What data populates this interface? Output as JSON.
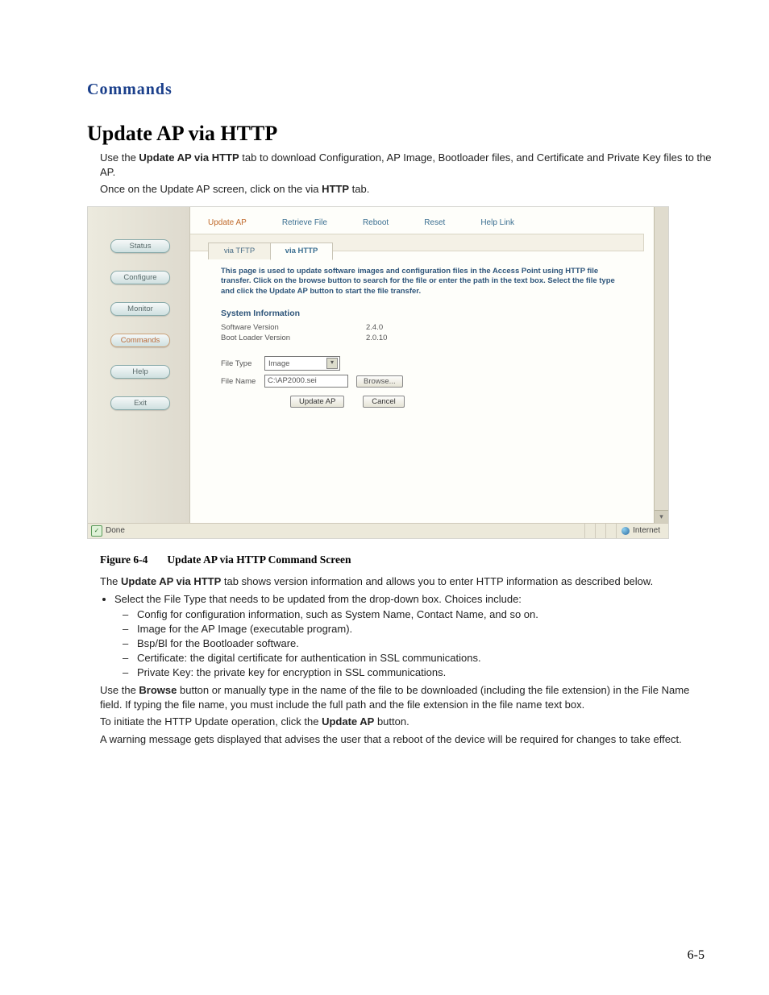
{
  "header": {
    "section": "Commands",
    "title": "Update AP via HTTP"
  },
  "intro": {
    "p1a": "Use the ",
    "p1b": "Update AP via HTTP",
    "p1c": " tab to download Configuration, AP Image, Bootloader files, and Certificate and Private Key files to the AP.",
    "p2a": "Once on the Update AP screen, click on the via ",
    "p2b": "HTTP",
    "p2c": " tab."
  },
  "screenshot": {
    "side": {
      "status": "Status",
      "configure": "Configure",
      "monitor": "Monitor",
      "commands": "Commands",
      "help": "Help",
      "exit": "Exit"
    },
    "top_tabs": {
      "update": "Update AP",
      "retrieve": "Retrieve File",
      "reboot": "Reboot",
      "reset": "Reset",
      "help": "Help Link"
    },
    "sub_tabs": {
      "tftp": "via TFTP",
      "http": "via HTTP"
    },
    "desc": "This page is used to update software images and configuration files in the Access Point using HTTP file transfer. Click on the browse button to search for the file or enter the path in the text box. Select the file type and click the Update AP button to start the file transfer.",
    "sys": {
      "head": "System Information",
      "sw_label": "Software Version",
      "sw_val": "2.4.0",
      "bl_label": "Boot Loader Version",
      "bl_val": "2.0.10"
    },
    "form": {
      "filetype_label": "File Type",
      "filetype_value": "Image",
      "filename_label": "File Name",
      "filename_value": "C:\\AP2000.sei",
      "browse": "Browse...",
      "update": "Update AP",
      "cancel": "Cancel"
    },
    "status": {
      "done": "Done",
      "zone": "Internet"
    }
  },
  "figure": {
    "num": "Figure 6-4",
    "title": "Update AP via HTTP Command Screen"
  },
  "after": {
    "p1a": "The ",
    "p1b": "Update AP via HTTP",
    "p1c": " tab shows version information and allows you to enter HTTP information as described below.",
    "li_top": "Select the File Type that needs to be updated from the drop-down box. Choices include:",
    "c1a": "Config",
    "c1b": " for configuration information, such as System Name, Contact Name, and so on.",
    "c2a": "Image",
    "c2b": " for the AP Image (executable program).",
    "c3a": "Bsp/Bl",
    "c3b": " for the Bootloader software.",
    "c4a": "Certificate",
    "c4b": ": the digital certificate for authentication in SSL communications.",
    "c5a": "Private Key",
    "c5b": ": the private key for encryption in SSL communications.",
    "p2a": "Use the ",
    "p2b": "Browse",
    "p2c": " button or manually type in the name of the file to be downloaded (including the file extension) in the File Name field. If typing the file name, you must include the full path and the file extension in the file name text box.",
    "p3a": "To initiate the HTTP Update operation, click the ",
    "p3b": "Update AP",
    "p3c": " button.",
    "p4": "A warning message gets displayed that advises the user that a reboot of the device will be required for changes to take effect."
  },
  "page_number": "6-5"
}
